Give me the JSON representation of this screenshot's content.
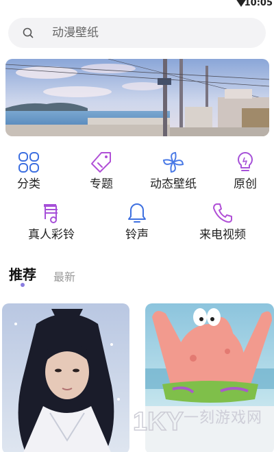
{
  "status": {
    "time": "10:05",
    "icon": "wifi-icon"
  },
  "search": {
    "placeholder": "动漫壁纸",
    "icon": "search-icon"
  },
  "banner": {
    "alt": "seaside railway scene"
  },
  "categories": [
    {
      "label": "分类",
      "icon": "grid-icon",
      "color": "#3d6fe0"
    },
    {
      "label": "专题",
      "icon": "tag-icon",
      "color": "#b04fd6"
    },
    {
      "label": "动态壁纸",
      "icon": "pinwheel-icon",
      "color": "#4a7ae6"
    },
    {
      "label": "原创",
      "icon": "lightbulb-icon",
      "color": "#a652d8"
    },
    {
      "label": "真人彩铃",
      "icon": "music-note-icon",
      "color": "#a64fd8"
    },
    {
      "label": "铃声",
      "icon": "bell-icon",
      "color": "#3d6fe0"
    },
    {
      "label": "来电视频",
      "icon": "phone-icon",
      "color": "#b04fd6"
    }
  ],
  "tabs": {
    "active": "推荐",
    "inactive": "最新"
  },
  "watermark": {
    "text": "一刻游戏网",
    "logo": "1KY"
  }
}
